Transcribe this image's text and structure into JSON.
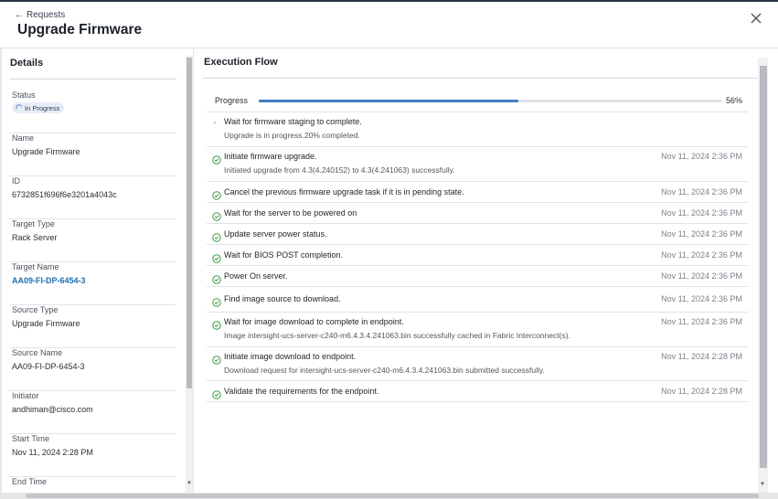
{
  "header": {
    "back_label": "Requests",
    "title": "Upgrade Firmware"
  },
  "details": {
    "title": "Details",
    "items": [
      {
        "label": "Status",
        "value": "In Progress"
      },
      {
        "label": "Name",
        "value": "Upgrade Firmware"
      },
      {
        "label": "ID",
        "value": "6732851f696f6e3201a4043c"
      },
      {
        "label": "Target Type",
        "value": "Rack Server"
      },
      {
        "label": "Target Name",
        "value": "AA09-FI-DP-6454-3"
      },
      {
        "label": "Source Type",
        "value": "Upgrade Firmware"
      },
      {
        "label": "Source Name",
        "value": "AA09-FI-DP-6454-3"
      },
      {
        "label": "Initiator",
        "value": "andhiman@cisco.com"
      },
      {
        "label": "Start Time",
        "value": "Nov 11, 2024 2:28 PM"
      },
      {
        "label": "End Time",
        "value": ""
      }
    ]
  },
  "execution": {
    "title": "Execution Flow",
    "progress_label": "Progress",
    "progress_percent_text": "56%",
    "progress_fraction": 0.56,
    "steps": [
      {
        "status": "in-progress",
        "title": "Wait for firmware staging to complete.",
        "detail": "Upgrade is in progress.20% completed.",
        "time": ""
      },
      {
        "status": "success",
        "title": "Initiate firmware upgrade.",
        "detail": "Initiated upgrade from 4.3(4.240152) to 4.3(4.241063) successfully.",
        "time": "Nov 11, 2024 2:36 PM"
      },
      {
        "status": "success",
        "title": "Cancel the previous firmware upgrade task if it is in pending state.",
        "detail": "",
        "time": "Nov 11, 2024 2:36 PM"
      },
      {
        "status": "success",
        "title": "Wait for the server to be powered on",
        "detail": "",
        "time": "Nov 11, 2024 2:36 PM"
      },
      {
        "status": "success",
        "title": "Update server power status.",
        "detail": "",
        "time": "Nov 11, 2024 2:36 PM"
      },
      {
        "status": "success",
        "title": "Wait for BIOS POST completion.",
        "detail": "",
        "time": "Nov 11, 2024 2:36 PM"
      },
      {
        "status": "success",
        "title": "Power On server.",
        "detail": "",
        "time": "Nov 11, 2024 2:36 PM"
      },
      {
        "status": "success",
        "title": "Find image source to download.",
        "detail": "",
        "time": "Nov 11, 2024 2:36 PM"
      },
      {
        "status": "success",
        "title": "Wait for image download to complete in endpoint.",
        "detail": "Image intersight-ucs-server-c240-m6.4.3.4.241063.bin successfully cached in Fabric Interconnect(s).",
        "time": "Nov 11, 2024 2:36 PM"
      },
      {
        "status": "success",
        "title": "Initiate image download to endpoint.",
        "detail": "Download request for intersight-ucs-server-c240-m6.4.3.4.241063.bin submitted successfully.",
        "time": "Nov 11, 2024 2:28 PM"
      },
      {
        "status": "success",
        "title": "Validate the requirements for the endpoint.",
        "detail": "",
        "time": "Nov 11, 2024 2:28 PM"
      }
    ]
  },
  "colors": {
    "success": "#3d9a45",
    "progress": "#3f7fc1",
    "link": "#1e6fb0"
  },
  "icons": {
    "back": "arrow-left-icon",
    "close": "close-icon",
    "success": "check-circle-icon",
    "in_progress": "spinner-icon"
  }
}
